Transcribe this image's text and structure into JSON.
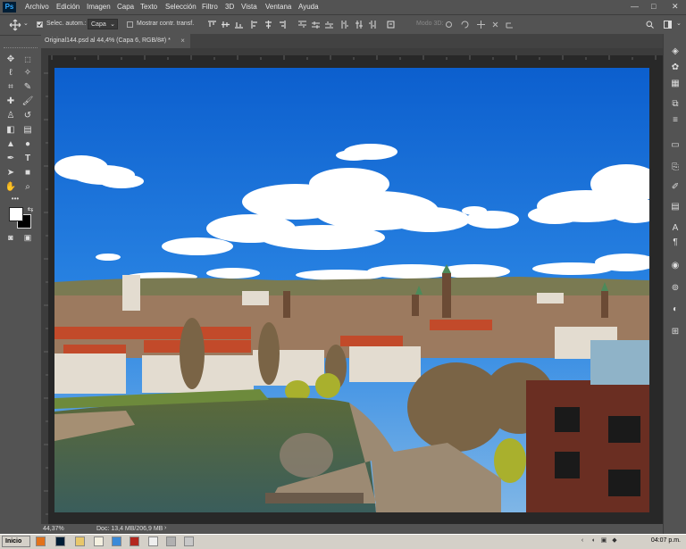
{
  "app": {
    "logo_text": "Ps"
  },
  "menu": {
    "items": [
      "Archivo",
      "Edición",
      "Imagen",
      "Capa",
      "Texto",
      "Selección",
      "Filtro",
      "3D",
      "Vista",
      "Ventana",
      "Ayuda"
    ]
  },
  "window_controls": {
    "minimize": "—",
    "maximize": "□",
    "close": "✕"
  },
  "options_bar": {
    "auto_select_label": "Selec. autom.:",
    "auto_select_checked": true,
    "auto_select_value": "Capa",
    "transform_label": "Mostrar contr. transf.",
    "transform_checked": false,
    "mode_3d_label": "Modo 3D:"
  },
  "document": {
    "tab_title": "Original144.psd al 44,4% (Capa 6, RGB/8#) *",
    "tab_close": "×"
  },
  "status": {
    "zoom": "44,37%",
    "doc_info": "Doc: 13,4 MB/206,9 MB"
  },
  "colors": {
    "sky": "#1a6fd6",
    "panel": "#535353",
    "canvas_bg": "#282828",
    "accent": "#31a8ff"
  },
  "taskbar": {
    "start_label": "Inicio",
    "clock": "04:07 p.m."
  }
}
